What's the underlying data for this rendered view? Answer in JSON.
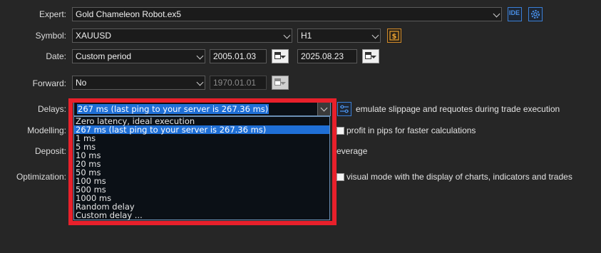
{
  "expert": {
    "label": "Expert:",
    "value": "Gold Chameleon Robot.ex5",
    "ide_button": "IDE",
    "settings_icon": "gear-icon"
  },
  "symbol": {
    "label": "Symbol:",
    "value": "XAUUSD",
    "timeframe": "H1",
    "spec_icon": "dollar-chart-icon"
  },
  "date": {
    "label": "Date:",
    "mode": "Custom period",
    "from": "2005.01.03",
    "to": "2025.08.23"
  },
  "forward": {
    "label": "Forward:",
    "mode": "No",
    "date": "1970.01.01"
  },
  "delays": {
    "label": "Delays:",
    "value": "267 ms (last ping to your server is 267.36 ms)",
    "options": [
      "Zero latency, ideal execution",
      "267 ms (last ping to your server is 267.36 ms)",
      "1 ms",
      "5 ms",
      "10 ms",
      "20 ms",
      "50 ms",
      "100 ms",
      "500 ms",
      "1000 ms",
      "Random delay",
      "Custom delay ..."
    ],
    "selected_index": 1,
    "emulate_text": "emulate slippage and requotes during trade execution"
  },
  "modelling": {
    "label": "Modelling:",
    "profit_text": "profit in pips for faster calculations"
  },
  "deposit": {
    "label": "Deposit:",
    "leverage_text": "everage"
  },
  "optimization": {
    "label": "Optimization:",
    "visual_text": "visual mode with the display of charts, indicators and trades"
  },
  "colors": {
    "highlight": "#e8202b",
    "selection": "#1f6fd6",
    "accent": "#3b7fd6"
  }
}
